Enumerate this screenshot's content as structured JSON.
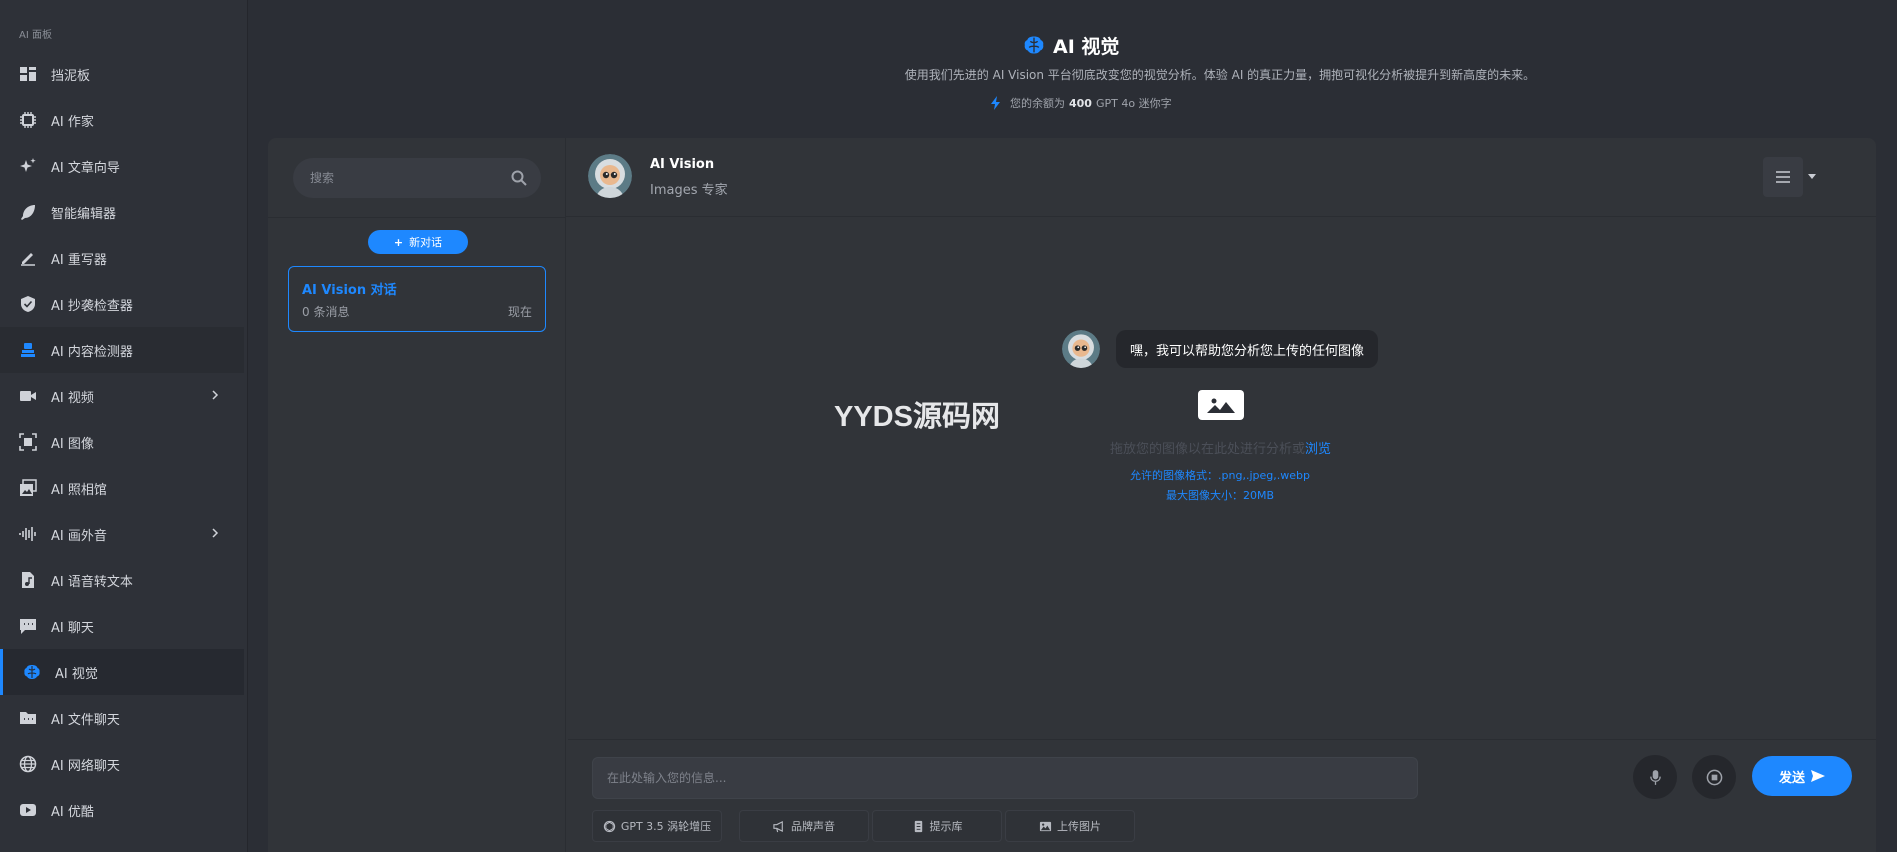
{
  "sidebar": {
    "section_label": "AI 面板",
    "items": [
      {
        "label": "挡泥板",
        "icon": "dashboard-icon"
      },
      {
        "label": "AI 作家",
        "icon": "chip-icon"
      },
      {
        "label": "AI 文章向导",
        "icon": "sparkles-icon"
      },
      {
        "label": "智能编辑器",
        "icon": "feather-icon"
      },
      {
        "label": "AI 重写器",
        "icon": "pen-icon"
      },
      {
        "label": "AI 抄袭检查器",
        "icon": "shield-check-icon"
      },
      {
        "label": "AI 内容检测器",
        "icon": "detector-icon"
      },
      {
        "label": "AI 视频",
        "icon": "video-icon"
      },
      {
        "label": "AI 图像",
        "icon": "image-scan-icon"
      },
      {
        "label": "AI 照相馆",
        "icon": "photo-gallery-icon"
      },
      {
        "label": "AI 画外音",
        "icon": "waveform-icon"
      },
      {
        "label": "AI 语音转文本",
        "icon": "audio-file-icon"
      },
      {
        "label": "AI 聊天",
        "icon": "chat-icon"
      },
      {
        "label": "AI 视觉",
        "icon": "brain-icon"
      },
      {
        "label": "AI 文件聊天",
        "icon": "folder-icon"
      },
      {
        "label": "AI 网络聊天",
        "icon": "globe-icon"
      },
      {
        "label": "AI 优酷",
        "icon": "youtube-icon"
      }
    ]
  },
  "header": {
    "title": "AI 视觉",
    "subtitle": "使用我们先进的 AI Vision 平台彻底改变您的视觉分析。体验 AI 的真正力量，拥抱可视化分析被提升到新高度的未来。",
    "balance_prefix": "您的余额为",
    "balance_value": "400",
    "balance_suffix": "GPT 4o 迷你字"
  },
  "left_panel": {
    "search_placeholder": "搜索",
    "new_chat_label": "新对话",
    "conversations": [
      {
        "title": "AI Vision 对话",
        "messages": "0 条消息",
        "time": "现在"
      }
    ]
  },
  "chat": {
    "bot_name": "AI Vision",
    "bot_role": "Images 专家",
    "greeting": "嘿，我可以帮助您分析您上传的任何图像",
    "drop_text": "拖放您的图像以在此处进行分析或",
    "browse_label": "浏览",
    "formats": "允许的图像格式：.png,.jpeg,.webp",
    "max_size": "最大图像大小：20MB",
    "watermark": "YYDS源码网"
  },
  "composer": {
    "placeholder": "在此处输入您的信息...",
    "send_label": "发送",
    "tools": [
      {
        "label": "GPT 3.5 涡轮增压",
        "icon": "openai-icon"
      },
      {
        "label": "品牌声音",
        "icon": "megaphone-icon"
      },
      {
        "label": "提示库",
        "icon": "library-icon"
      },
      {
        "label": "上传图片",
        "icon": "upload-image-icon"
      }
    ]
  },
  "colors": {
    "accent": "#1e88ff",
    "background": "#2b2e35",
    "card": "#313439"
  }
}
